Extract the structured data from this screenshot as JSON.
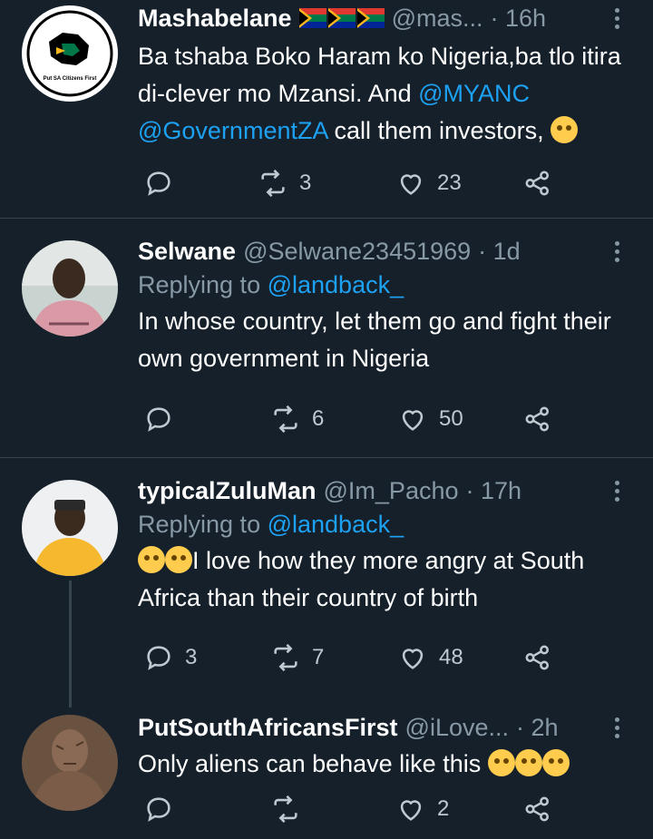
{
  "tweets": [
    {
      "name": "Mashabelane",
      "handle": "@mas...",
      "time": "· 16h",
      "avatar_text": "Put SA Citizens First",
      "text_parts": [
        "Ba tshaba Boko Haram ko Nigeria,ba tlo itira di-clever mo Mzansi. And ",
        "@MYANC",
        " ",
        "@GovernmentZA",
        " call them investors,"
      ],
      "emoji": "thinking-face",
      "retweets": "3",
      "likes": "23",
      "replies": ""
    },
    {
      "name": "Selwane",
      "handle": "@Selwane23451969",
      "time": "· 1d",
      "replying_prefix": "Replying to ",
      "replying_to": "@landback_",
      "text": "In whose country, let them go and fight their own government in Nigeria",
      "retweets": "6",
      "likes": "50",
      "replies": ""
    },
    {
      "name": "typicalZuluMan",
      "handle": "@Im_Pacho",
      "time": "· 17h",
      "replying_prefix": "Replying to ",
      "replying_to": "@landback_",
      "text": "I love how they more angry at South Africa than their country of birth",
      "emoji": "crying-laughing-face",
      "replies": "3",
      "retweets": "7",
      "likes": "48"
    },
    {
      "name": "PutSouthAfricansFirst",
      "handle": "@iLove...",
      "time": "· 2h",
      "text": "Only aliens can behave like this",
      "emoji": "rolling-eyes-face",
      "replies": "",
      "retweets": "",
      "likes": "2"
    }
  ],
  "colors": {
    "background": "#15202b",
    "link": "#1da1f2",
    "muted": "#8899a6",
    "divider": "#38444d"
  }
}
